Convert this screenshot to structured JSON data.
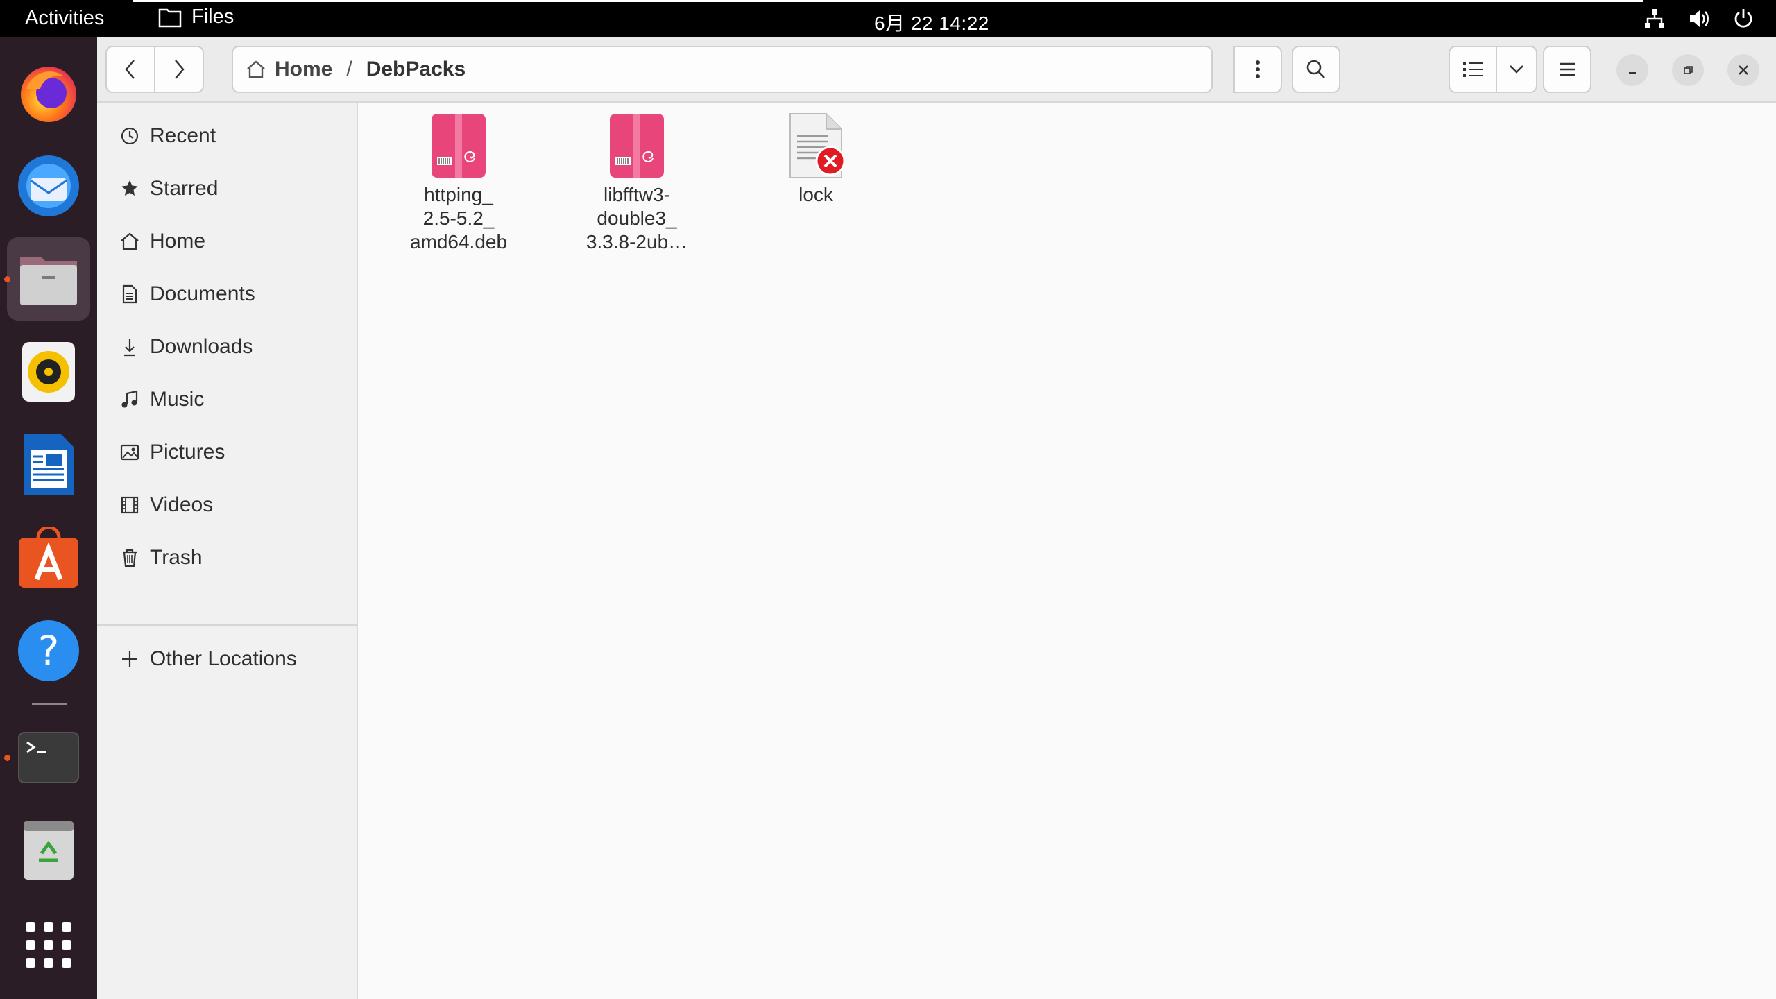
{
  "topbar": {
    "activities": "Activities",
    "app_name": "Files",
    "clock": "6月 22  14:22",
    "tray": [
      "network-icon",
      "volume-icon",
      "power-icon"
    ]
  },
  "dock": {
    "apps": [
      {
        "name": "firefox"
      },
      {
        "name": "thunderbird"
      },
      {
        "name": "files",
        "active": true
      },
      {
        "name": "rhythmbox"
      },
      {
        "name": "libreoffice-writer"
      },
      {
        "name": "ubuntu-software"
      },
      {
        "name": "help"
      },
      {
        "name": "terminal",
        "running": true
      },
      {
        "name": "trash"
      },
      {
        "name": "show-applications"
      }
    ]
  },
  "header": {
    "breadcrumb": [
      "Home",
      "DebPacks"
    ]
  },
  "sidebar": {
    "items": [
      {
        "label": "Recent",
        "icon": "clock-icon"
      },
      {
        "label": "Starred",
        "icon": "star-icon"
      },
      {
        "label": "Home",
        "icon": "home-icon"
      },
      {
        "label": "Documents",
        "icon": "document-icon"
      },
      {
        "label": "Downloads",
        "icon": "download-icon"
      },
      {
        "label": "Music",
        "icon": "music-icon"
      },
      {
        "label": "Pictures",
        "icon": "picture-icon"
      },
      {
        "label": "Videos",
        "icon": "video-icon"
      },
      {
        "label": "Trash",
        "icon": "trash-icon"
      }
    ],
    "other_locations": "Other Locations"
  },
  "files": [
    {
      "name": "httping_\n2.5-5.2_\namd64.deb",
      "type": "deb"
    },
    {
      "name": "libfftw3-\ndouble3_\n3.3.8-2ub…",
      "type": "deb"
    },
    {
      "name": "lock",
      "type": "locked-text"
    }
  ],
  "colors": {
    "accent": "#e95420",
    "deb": "#e8457a",
    "dock_bg": "#2a1d26"
  }
}
